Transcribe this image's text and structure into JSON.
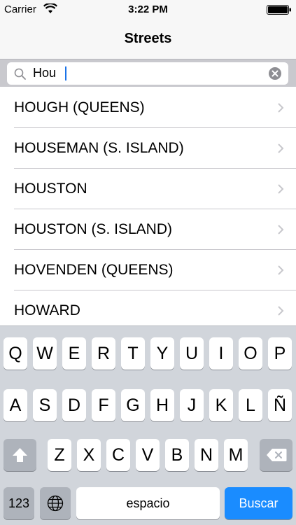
{
  "status_bar": {
    "carrier": "Carrier",
    "time": "3:22 PM",
    "wifi_icon": "wifi-icon",
    "battery_icon": "battery-icon"
  },
  "nav": {
    "title": "Streets"
  },
  "search": {
    "value": "Hou",
    "search_icon": "search-icon",
    "clear_icon": "clear-icon"
  },
  "results": [
    {
      "label": "HOUGH (QUEENS)"
    },
    {
      "label": "HOUSEMAN (S. ISLAND)"
    },
    {
      "label": "HOUSTON"
    },
    {
      "label": "HOUSTON (S. ISLAND)"
    },
    {
      "label": "HOVENDEN (QUEENS)"
    },
    {
      "label": "HOWARD"
    }
  ],
  "keyboard": {
    "row1": [
      "Q",
      "W",
      "E",
      "R",
      "T",
      "Y",
      "U",
      "I",
      "O",
      "P"
    ],
    "row2": [
      "A",
      "S",
      "D",
      "F",
      "G",
      "H",
      "J",
      "K",
      "L",
      "Ñ"
    ],
    "row3": [
      "Z",
      "X",
      "C",
      "V",
      "B",
      "N",
      "M"
    ],
    "numbers_label": "123",
    "space_label": "espacio",
    "go_label": "Buscar",
    "shift_icon": "shift-icon",
    "delete_icon": "delete-icon",
    "globe_icon": "globe-icon",
    "go_color": "#1a8cff"
  }
}
